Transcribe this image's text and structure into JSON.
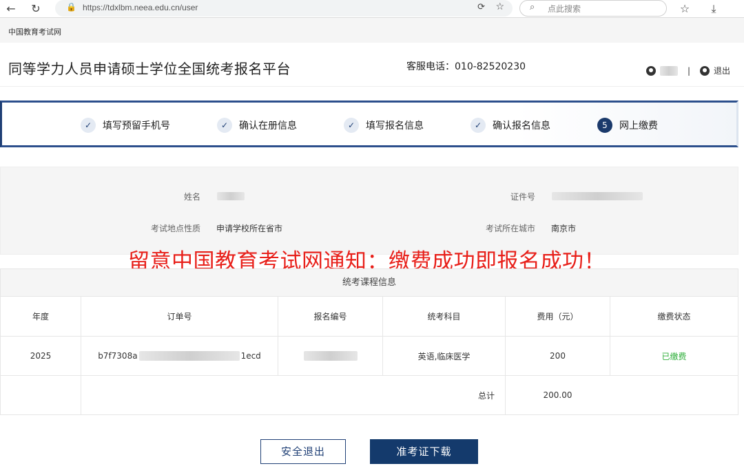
{
  "browser": {
    "url": "https://tdxlbm.neea.edu.cn/user",
    "search_placeholder": "点此搜索",
    "tab_title": "中国教育考试网"
  },
  "header": {
    "site_title": "同等学力人员申请硕士学位全国统考报名平台",
    "hotline": "客服电话：010-82520230",
    "separator": "|",
    "logout": "退出"
  },
  "steps": [
    {
      "label": "填写预留手机号",
      "mark": "✓"
    },
    {
      "label": "确认在册信息",
      "mark": "✓"
    },
    {
      "label": "填写报名信息",
      "mark": "✓"
    },
    {
      "label": "确认报名信息",
      "mark": "✓"
    },
    {
      "label": "网上缴费",
      "mark": "5"
    }
  ],
  "info": {
    "name_label": "姓名",
    "id_label": "证件号",
    "site_type_label": "考试地点性质",
    "site_type_value": "申请学校所在省市",
    "city_label": "考试所在城市",
    "city_value": "南京市"
  },
  "notice": "留意中国教育考试网通知：缴费成功即报名成功！",
  "table": {
    "caption": "统考课程信息",
    "headers": [
      "年度",
      "订单号",
      "报名编号",
      "统考科目",
      "费用（元）",
      "缴费状态"
    ],
    "row": {
      "year": "2025",
      "order_prefix": "b7f7308a",
      "order_suffix": "1ecd",
      "subject": "英语,临床医学",
      "fee": "200",
      "status": "已缴费"
    },
    "total_label": "总计",
    "total_value": "200.00"
  },
  "buttons": {
    "exit": "安全退出",
    "download": "准考证下载"
  },
  "colors": {
    "primary": "#143a6c",
    "notice": "#e8201a",
    "paid": "#2eae3a"
  }
}
